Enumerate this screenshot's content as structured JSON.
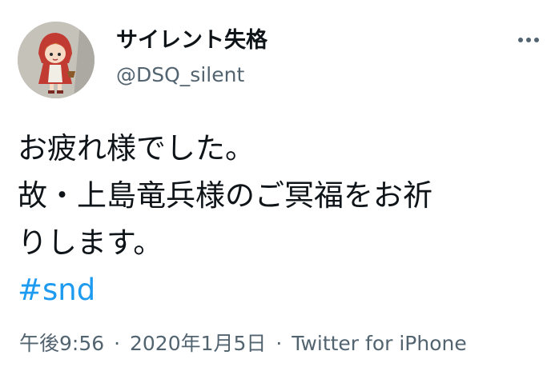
{
  "tweet": {
    "author": {
      "display_name": "サイレント失格",
      "handle": "@DSQ_silent",
      "avatar_icon": "avatar-illustration"
    },
    "text_lines": [
      "お疲れ様でした。",
      "故・上島竜兵様のご冥福をお祈",
      "りします。"
    ],
    "hashtag": "#snd",
    "timestamp": "午後9:56",
    "separator": "·",
    "date": "2020年1月5日",
    "source": "Twitter for iPhone",
    "more_icon": "more-dots-icon"
  },
  "colors": {
    "text": "#0f1419",
    "secondary": "#536471",
    "link": "#1d9bf0",
    "background": "#ffffff"
  }
}
